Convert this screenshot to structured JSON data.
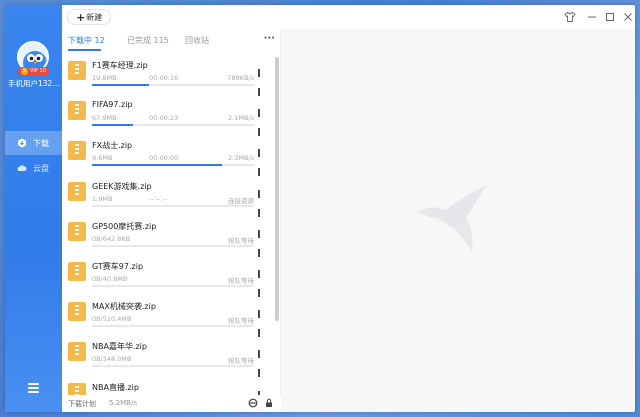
{
  "topbar": {
    "new_label": "新建"
  },
  "user": {
    "name": "手机用户132...",
    "vip_label": "VIP 10"
  },
  "nav": [
    {
      "label": "下载",
      "icon": "download-icon",
      "active": true
    },
    {
      "label": "云盘",
      "icon": "cloud-icon",
      "active": false
    }
  ],
  "tabs": [
    {
      "label": "下载中",
      "count": "12",
      "active": true
    },
    {
      "label": "已完成",
      "count": "115",
      "active": false
    },
    {
      "label": "回收站",
      "count": "",
      "active": false
    }
  ],
  "downloads": [
    {
      "name": "F1赛车经理.zip",
      "size": "19.8MB",
      "time": "00:00:16",
      "speed": "789KB/s",
      "progress": 0.35
    },
    {
      "name": "FIFA97.zip",
      "size": "67.9MB",
      "time": "00:00:23",
      "speed": "2.1MB/s",
      "progress": 0.25
    },
    {
      "name": "FX战士.zip",
      "size": "9.6MB",
      "time": "00:00:00",
      "speed": "2.3MB/s",
      "progress": 0.8
    },
    {
      "name": "GEEK游戏集.zip",
      "size": "1.9MB",
      "time": "--:--:--",
      "speed": "连接资源",
      "progress": 0.0
    },
    {
      "name": "GP500摩托赛.zip",
      "size": "0B/642.8KB",
      "time": "",
      "speed": "排队等待",
      "progress": 0.0
    },
    {
      "name": "GT赛车97.zip",
      "size": "0B/40.8MB",
      "time": "",
      "speed": "排队等待",
      "progress": 0.0
    },
    {
      "name": "MAX机械突袭.zip",
      "size": "0B/520.4MB",
      "time": "",
      "speed": "排队等待",
      "progress": 0.0
    },
    {
      "name": "NBA嘉年华.zip",
      "size": "0B/348.0MB",
      "time": "",
      "speed": "排队等待",
      "progress": 0.0
    },
    {
      "name": "NBA直播.zip",
      "size": "",
      "time": "",
      "speed": "",
      "progress": 0.0
    }
  ],
  "footer": {
    "plan_label": "下载计划",
    "total_speed": "5.2MB/s"
  },
  "colors": {
    "accent": "#2f7be8",
    "sidebar": "#3a86f0",
    "zip": "#f5b94a"
  }
}
